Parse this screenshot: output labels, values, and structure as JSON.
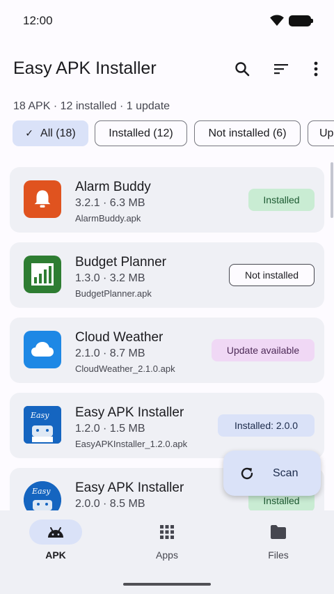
{
  "status": {
    "time": "12:00"
  },
  "header": {
    "title": "Easy APK Installer"
  },
  "summary": "18 APK · 12 installed · 1 update",
  "chips": [
    {
      "label": "All (18)",
      "selected": true
    },
    {
      "label": "Installed (12)",
      "selected": false
    },
    {
      "label": "Not installed (6)",
      "selected": false
    },
    {
      "label": "Up",
      "selected": false
    }
  ],
  "apps": [
    {
      "name": "Alarm Buddy",
      "version": "3.2.1 · 6.3 MB",
      "file": "AlarmBuddy.apk",
      "status": "Installed",
      "icon": "bell-icon",
      "icon_color": "#e0531f"
    },
    {
      "name": "Budget Planner",
      "version": "1.3.0 · 3.2 MB",
      "file": "BudgetPlanner.apk",
      "status": "Not installed",
      "icon": "bar-chart-icon",
      "icon_color": "#2e7d32"
    },
    {
      "name": "Cloud Weather",
      "version": "2.1.0 · 8.7 MB",
      "file": "CloudWeather_2.1.0.apk",
      "status": "Update available",
      "icon": "cloud-icon",
      "icon_color": "#1e88e5"
    },
    {
      "name": "Easy APK Installer",
      "version": "1.2.0 · 1.5 MB",
      "file": "EasyAPKInstaller_1.2.0.apk",
      "status": "Installed: 2.0.0",
      "icon": "easy-android-icon",
      "icon_color": "#1565c0",
      "icon_text": "Easy"
    },
    {
      "name": "Easy APK Installer",
      "version": "2.0.0 · 8.5 MB",
      "file": "",
      "status": "Installed",
      "icon": "easy-android-icon",
      "icon_color": "#1565c0",
      "icon_text": "Easy"
    }
  ],
  "fab": {
    "label": "Scan",
    "icon": "refresh-icon"
  },
  "nav": [
    {
      "label": "APK",
      "icon": "android-icon",
      "active": true
    },
    {
      "label": "Apps",
      "icon": "grid-icon",
      "active": false
    },
    {
      "label": "Files",
      "icon": "folder-icon",
      "active": false
    }
  ],
  "colors": {
    "accent_container": "#dae2f8",
    "installed": "#c9ecd3",
    "update": "#f0d8f5",
    "surface": "#eff0f5"
  }
}
